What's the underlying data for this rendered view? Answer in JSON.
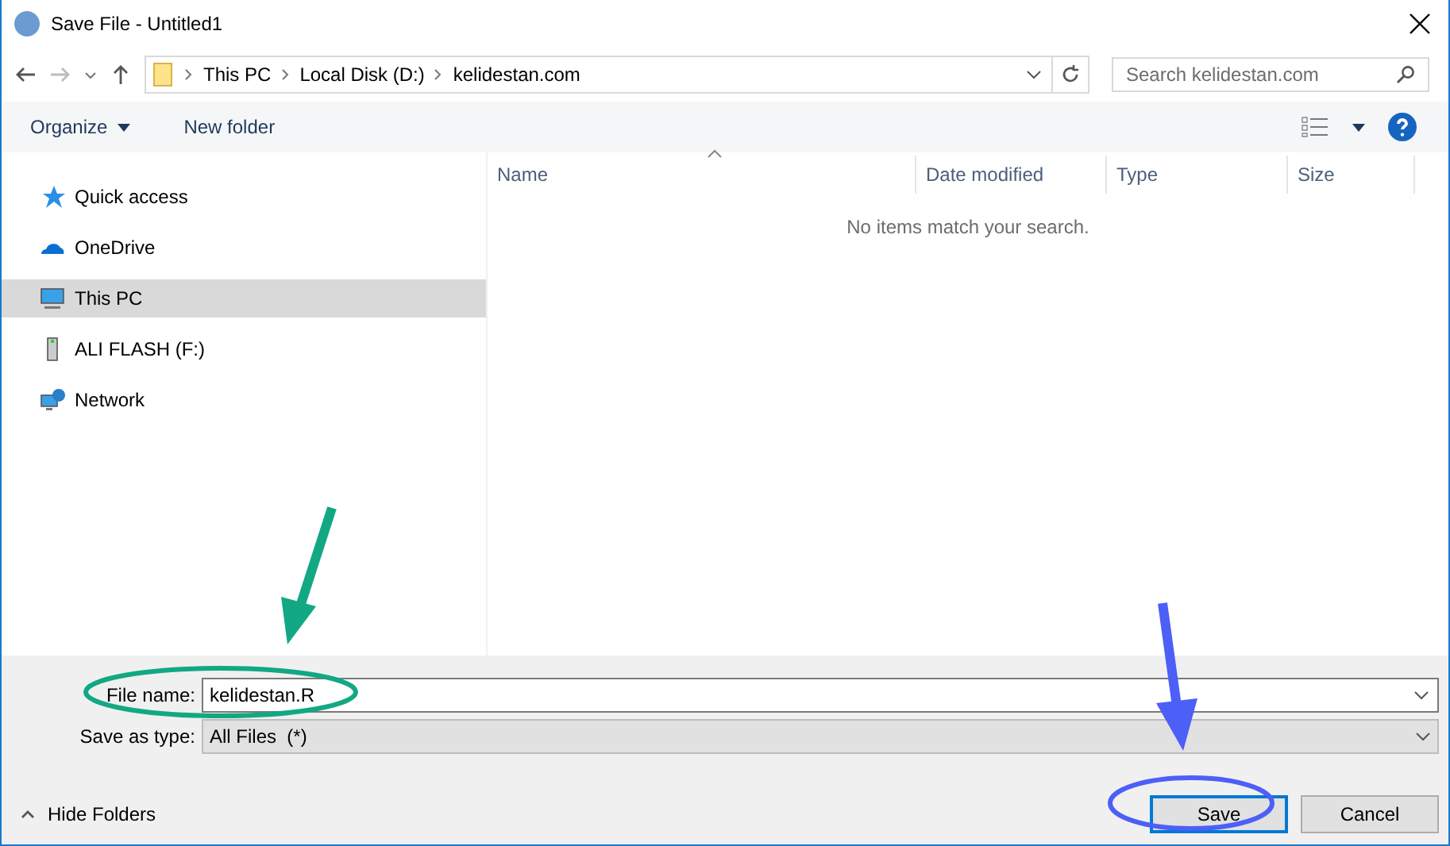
{
  "window": {
    "title": "Save File - Untitled1"
  },
  "address_bar": {
    "crumbs": [
      "This PC",
      "Local Disk (D:)",
      "kelidestan.com"
    ]
  },
  "search": {
    "placeholder": "Search kelidestan.com"
  },
  "toolbar": {
    "organize": "Organize",
    "new_folder": "New folder"
  },
  "sidebar": {
    "items": [
      {
        "label": "Quick access",
        "kind": "star",
        "selected": false
      },
      {
        "label": "OneDrive",
        "kind": "cloud",
        "selected": false
      },
      {
        "label": "This PC",
        "kind": "pc",
        "selected": true
      },
      {
        "label": "ALI FLASH (F:)",
        "kind": "drive",
        "selected": false
      },
      {
        "label": "Network",
        "kind": "network",
        "selected": false
      }
    ]
  },
  "table": {
    "columns": [
      "Name",
      "Date modified",
      "Type",
      "Size"
    ],
    "empty_message": "No items match your search."
  },
  "file_name": {
    "label": "File name:",
    "value": "kelidestan.R"
  },
  "save_as_type": {
    "label": "Save as type:",
    "value": "All Files  (*)"
  },
  "hide_folders": "Hide Folders",
  "buttons": [
    {
      "label": "Save",
      "default": true
    },
    {
      "label": "Cancel",
      "default": false
    }
  ]
}
